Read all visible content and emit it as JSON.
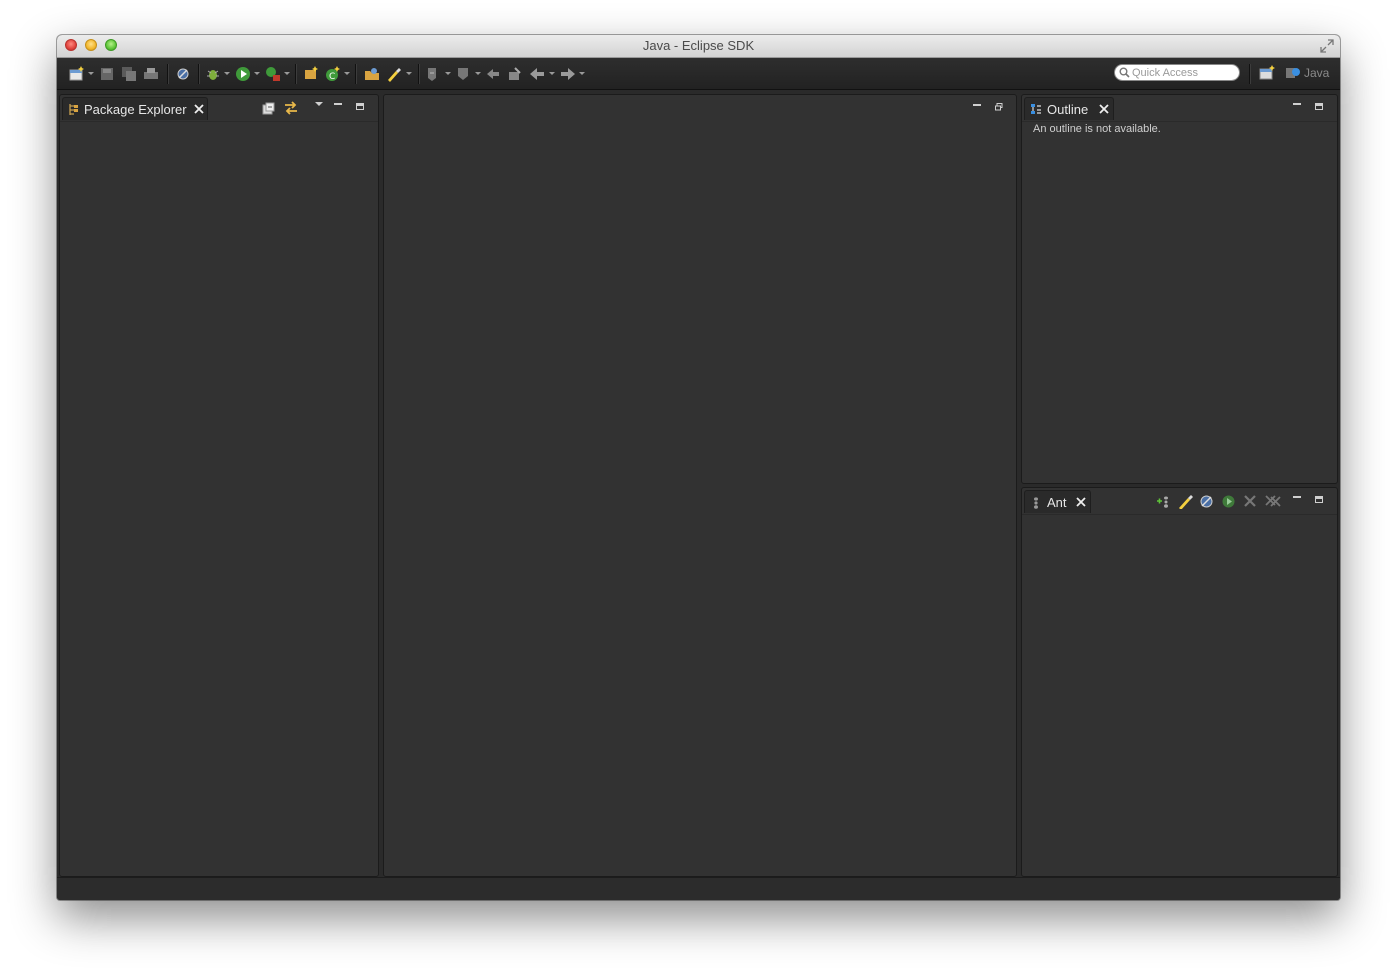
{
  "window": {
    "title": "Java - Eclipse SDK"
  },
  "toolbar": {
    "quick_access_placeholder": "Quick Access",
    "perspective_label": "Java"
  },
  "package_explorer": {
    "tab_label": "Package Explorer"
  },
  "outline": {
    "tab_label": "Outline",
    "message": "An outline is not available."
  },
  "ant": {
    "tab_label": "Ant"
  },
  "colors": {
    "background": "#323232",
    "accent_blue": "#3a8fe0"
  }
}
